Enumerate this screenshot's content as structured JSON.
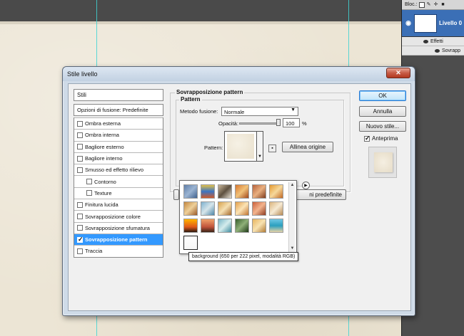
{
  "layers_panel": {
    "lock_label": "Bloc.:",
    "layer_name": "Livello 0",
    "effects_label": "Effetti",
    "effect_item": "Sovrapp"
  },
  "dialog": {
    "title": "Stile livello",
    "styles_header": "Stili",
    "blend_options": "Opzioni di fusione: Predefinite",
    "styles": [
      {
        "label": "Ombra esterna",
        "checked": false
      },
      {
        "label": "Ombra interna",
        "checked": false
      },
      {
        "label": "Bagliore esterno",
        "checked": false
      },
      {
        "label": "Bagliore interno",
        "checked": false
      },
      {
        "label": "Smusso ed effetto rilievo",
        "checked": false
      },
      {
        "label": "Contorno",
        "checked": false
      },
      {
        "label": "Texture",
        "checked": false
      },
      {
        "label": "Finitura lucida",
        "checked": false
      },
      {
        "label": "Sovrapposizione colore",
        "checked": false
      },
      {
        "label": "Sovrapposizione sfumatura",
        "checked": false
      },
      {
        "label": "Sovrapposizione pattern",
        "checked": true
      },
      {
        "label": "Traccia",
        "checked": false
      }
    ],
    "section_title": "Sovrapposizione pattern",
    "group_title": "Pattern",
    "blend_mode_label": "Metodo fusione:",
    "blend_mode_value": "Normale",
    "opacity_label": "Opacità:",
    "opacity_value": "100",
    "opacity_unit": "%",
    "opacity_fraction": 1.0,
    "pattern_label": "Pattern:",
    "snap_origin_button": "Allinea origine",
    "default_button_partial": "ni predefinite",
    "ok_button": "OK",
    "cancel_button": "Annulla",
    "new_style_button": "Nuovo stile...",
    "preview_label": "Anteprima",
    "preview_checked": true,
    "tooltip": "background (650 per 222 pixel, modalità RGB)"
  },
  "colors": {
    "selection": "#3399ff",
    "guide": "#3fd3d3",
    "layer_selected": "#3b6fb6"
  }
}
